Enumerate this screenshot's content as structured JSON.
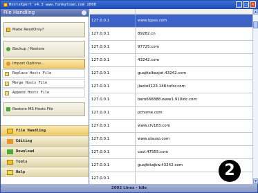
{
  "window": {
    "title": "HostsXpert v4.3   www.funkytoad.com 2008",
    "buttons": [
      "_",
      "□",
      "×"
    ]
  },
  "left_pane": {
    "header": "File Handling",
    "tasks": [
      {
        "label": "Make ReadOnly?",
        "icon": "lock-icon"
      },
      {
        "label": "Backup / Restore",
        "icon": "backup-icon"
      },
      {
        "label": "Import Options...",
        "icon": "import-icon"
      }
    ],
    "import_items": [
      {
        "label": "Replace Hosts File",
        "icon": "replace-icon"
      },
      {
        "label": "Merge Hosts File",
        "icon": "merge-icon"
      },
      {
        "label": "Append Hosts File",
        "icon": "append-icon"
      }
    ],
    "restore_label": "Restore MS Hosts File",
    "categories": [
      {
        "label": "File Handling",
        "icon": "folder-icon"
      },
      {
        "label": "Editing",
        "icon": "pencil-icon"
      },
      {
        "label": "Download",
        "icon": "download-icon"
      },
      {
        "label": "Tools",
        "icon": "tools-icon"
      },
      {
        "label": "Help",
        "icon": "help-icon"
      }
    ]
  },
  "table": {
    "rows": [
      {
        "ip": "127.0.0.1",
        "host": "www.tgsss.com"
      },
      {
        "ip": "127.0.0.1",
        "host": "89282.cn"
      },
      {
        "ip": "127.0.0.1",
        "host": "97725.com"
      },
      {
        "ip": "127.0.0.1",
        "host": "43242.com"
      },
      {
        "ip": "127.0.0.1",
        "host": "guajitalkaajot.43242.com"
      },
      {
        "ip": "127.0.0.1",
        "host": "jiaotell123.148.tofor.com"
      },
      {
        "ip": "127.0.0.1",
        "host": "bem666888.www1.910idc.com"
      },
      {
        "ip": "127.0.0.1",
        "host": "pchome.com"
      },
      {
        "ip": "127.0.0.1",
        "host": "www.cfv183.com"
      },
      {
        "ip": "127.0.0.1",
        "host": "www.ulauso.com"
      },
      {
        "ip": "127.0.0.1",
        "host": "cool.47555.com"
      },
      {
        "ip": "127.0.0.1",
        "host": "guajfekajkw.43242.com"
      },
      {
        "ip": "127.0.0.1",
        "host": ""
      }
    ]
  },
  "badge": "2",
  "status": "2002 Lines - Idle"
}
